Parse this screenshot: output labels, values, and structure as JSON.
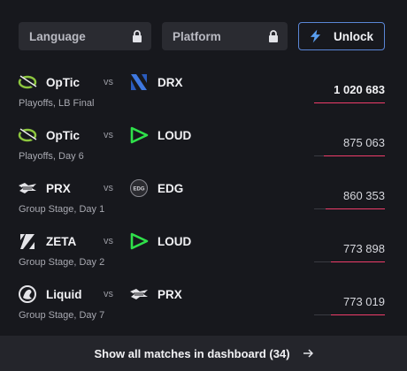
{
  "filters": {
    "language_label": "Language",
    "platform_label": "Platform",
    "unlock_label": "Unlock",
    "lock_icon": "lock-icon",
    "bolt_icon": "bolt-icon",
    "unlock_border_color": "#5a86d6"
  },
  "vs_label": "vs",
  "matches": [
    {
      "team_a": "OpTic",
      "logo_a": "optic-logo",
      "team_b": "DRX",
      "logo_b": "drx-logo",
      "stage": "Playoffs, LB Final",
      "viewers": "1 020 683",
      "bar_fraction": 1.0
    },
    {
      "team_a": "OpTic",
      "logo_a": "optic-logo",
      "team_b": "LOUD",
      "logo_b": "loud-logo",
      "stage": "Playoffs, Day 6",
      "viewers": "875 063",
      "bar_fraction": 0.857
    },
    {
      "team_a": "PRX",
      "logo_a": "prx-logo",
      "team_b": "EDG",
      "logo_b": "edg-logo",
      "stage": "Group Stage, Day 1",
      "viewers": "860 353",
      "bar_fraction": 0.843
    },
    {
      "team_a": "ZETA",
      "logo_a": "zeta-logo",
      "team_b": "LOUD",
      "logo_b": "loud-logo",
      "stage": "Group Stage, Day 2",
      "viewers": "773 898",
      "bar_fraction": 0.758
    },
    {
      "team_a": "Liquid",
      "logo_a": "liquid-logo",
      "team_b": "PRX",
      "logo_b": "prx-logo",
      "stage": "Group Stage, Day 7",
      "viewers": "773 019",
      "bar_fraction": 0.757
    }
  ],
  "footer": {
    "label": "Show all matches in dashboard (34)",
    "arrow_icon": "arrow-right-icon"
  },
  "colors": {
    "accent_pink": "#ef3d6a",
    "optic_green": "#8dc63f",
    "loud_green": "#2fe04a",
    "drx_blue": "#3f78e0"
  }
}
